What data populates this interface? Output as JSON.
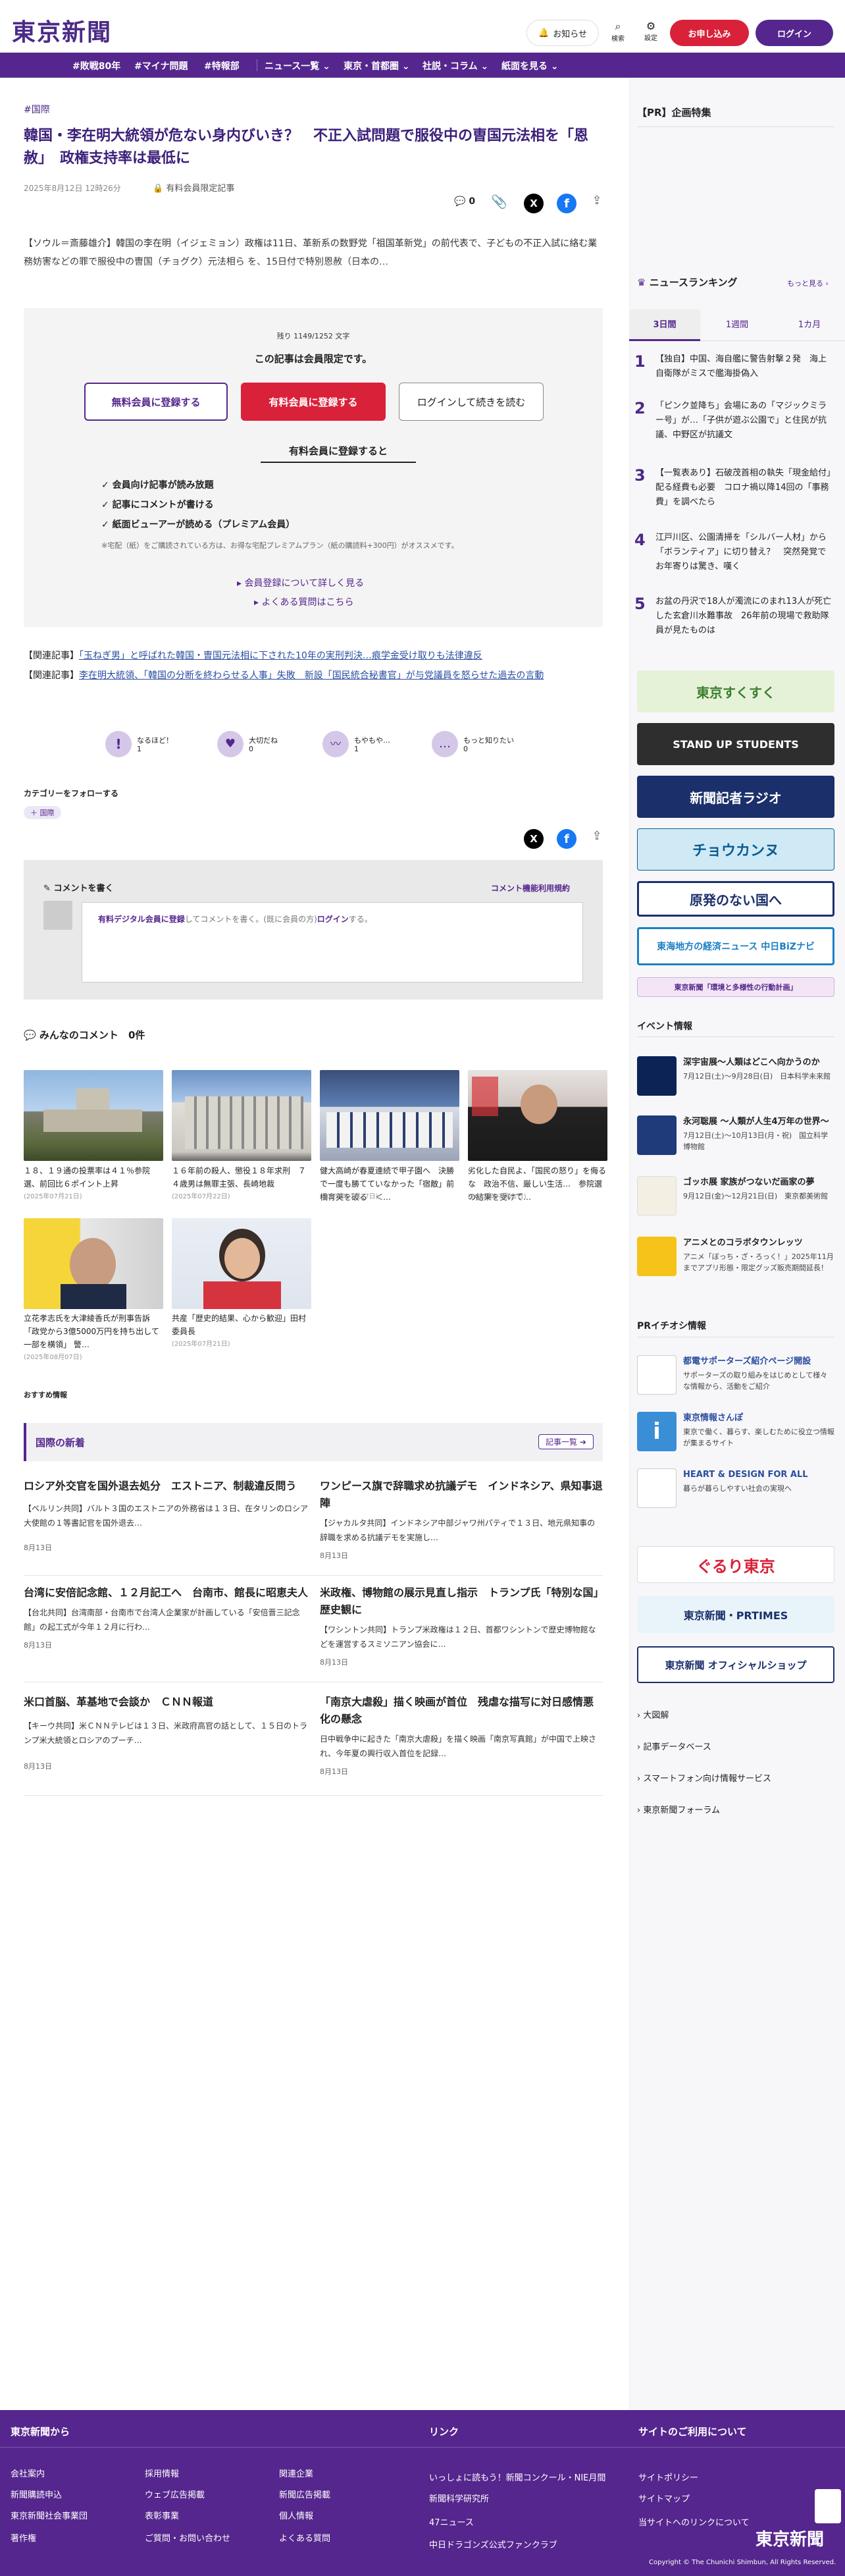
{
  "header": {
    "logo": "東京新聞",
    "notice": "お知らせ",
    "search": "検索",
    "settings": "設定",
    "signup": "お申し込み",
    "login": "ログイン"
  },
  "nav": {
    "items": [
      "#敗戦80年",
      "#マイナ問題",
      "#特報部",
      "ニュース一覧",
      "東京・首都圏",
      "社説・コラム",
      "紙面を見る"
    ]
  },
  "article": {
    "tag": "#国際",
    "title": "韓国・李在明大統領が危ない身内びいき？　不正入試問題で服役中の曺国元法相を「恩赦」　政権支持率は最低に",
    "date": "2025年8月12日 12時26分",
    "member_label": "有料会員限定記事",
    "comment_count": "0",
    "lead": "【ソウル＝斎藤雄介】韓国の李在明（イジェミョン）政権は11日、革新系の数野党「祖国革新党」の前代表で、子どもの不正入試に絡む業務妨害などの罪で服役中の曺国（チョグク）元法相ら を、15日付で特別恩赦（日本の…",
    "remaining": "残り 1149/1252 文字",
    "limited": "この記事は会員限定です。",
    "btn_free": "無料会員に登録する",
    "btn_paid": "有料会員に登録する",
    "btn_login": "ログインして続きを読む",
    "benefits_title": "有料会員に登録すると",
    "benefits": [
      "✓ 会員向け記事が読み放題",
      "✓ 記事にコメントが書ける",
      "✓ 紙面ビューアーが読める（プレミアム会員）"
    ],
    "note": "※宅配（紙）をご購読されている方は、お得な宅配プレミアムプラン（紙の購読料+300円）がオススメです。",
    "more1": "会員登録について詳しく見る",
    "more2": "よくある質問はこちら",
    "related1_label": "【関連記事】",
    "related1": "「玉ねぎ男」と呼ばれた韓国・曺国元法相に下された10年の実刑判決…痕学金受け取りも法律違反",
    "related2_label": "【関連記事】",
    "related2": "李在明大統領、「韓国の分断を終わらせる人事」失敗　新設「国民統合秘書官」が与党議員を怒らせた過去の言動",
    "reactions": [
      {
        "label": "なるほど！",
        "count": "1"
      },
      {
        "label": "大切だね",
        "count": "0"
      },
      {
        "label": "もやもや…",
        "count": "1"
      },
      {
        "label": "もっと知りたい",
        "count": "0"
      }
    ],
    "follow_label": "カテゴリーをフォローする",
    "follow_tag": "国際"
  },
  "comment": {
    "title": "コメントを書く",
    "rules": "コメント機能利用規約",
    "prompt_link": "有料デジタル会員に登録",
    "prompt_mid": "してコメントを書く。(既に会員の方)",
    "prompt_login": "ログイン",
    "prompt_end": "する。",
    "all_label": "みんなのコメント",
    "all_count": "0件"
  },
  "thumbs": [
    {
      "caption": "１８、１９通の投票率は４１％参院選、前回比６ポイント上昇",
      "date": "(2025年07月21日)"
    },
    {
      "caption": "１６年前の殺人、懲役１８年求刑　７４歳男は無罪主張、長崎地裁",
      "date": "(2025年07月22日)"
    },
    {
      "caption": "健大高崎が春夏連続で甲子園へ　決勝で一度も勝てていなかった「宿敵」前橋育英を破る　＜…",
      "date": "(2025年07月27日)"
    },
    {
      "caption": "劣化した自民よ、「国民の怒り」を侮るな　政治不信、厳しい生活…　参院選の結果を受けて…",
      "date": "(2025年07月21日)"
    },
    {
      "caption": "立花孝志氏を大津綾香氏が刑事告訴　「政党から3億5000万円を持ち出して一部を横領」 警…",
      "date": "(2025年08月07日)"
    },
    {
      "caption": "共産「歴史的結果、心から歓迎」田村委員長",
      "date": "(2025年07月21日)"
    }
  ],
  "recommend": "おすすめ情報",
  "intl": {
    "title": "国際の新着",
    "more": "記事一覧",
    "items": [
      {
        "title": "ロシア外交官を国外退去処分　エストニア、制裁違反問う",
        "body": "【ベルリン共同】バルト３国のエストニアの外務省は１３日、在タリンのロシア大使館の１等書記官を国外退去…",
        "date": "8月13日"
      },
      {
        "title": "ワンピース旗で辞職求め抗議デモ　インドネシア、県知事退陣",
        "body": "【ジャカルタ共同】インドネシア中部ジャワ州パティで１３日、地元県知事の辞職を求める抗議デモを実施し…",
        "date": "8月13日"
      },
      {
        "title": "台湾に安倍記念館、１２月記工へ　台南市、館長に昭恵夫人",
        "body": "【台北共同】台湾南部・台南市で台湾人企業家が計画している「安倍晋三記念館」の起工式が今年１２月に行わ…",
        "date": "8月13日"
      },
      {
        "title": "米政権、博物館の展示見直し指示　トランプ氏「特別な国」歴史観に",
        "body": "【ワシントン共同】トランプ米政権は１２日、首都ワシントンで歴史博物館などを運営するスミソニアン協会に…",
        "date": "8月13日"
      },
      {
        "title": "米口首脳、革基地で会談か　ＣＮＮ報道",
        "body": "【キーウ共同】米ＣＮＮテレビは１３日、米政府高官の話として、１５日のトランプ米大統領とロシアのプーチ…",
        "date": "8月13日"
      },
      {
        "title": "「南京大虐殺」描く映画が首位　残虐な描写に対日感情悪化の懸念",
        "body": "日中戦争中に起きた「南京大虐殺」を描く映画「南京写真館」が中国で上映され、今年夏の興行収入首位を記録…",
        "date": "8月13日"
      }
    ]
  },
  "sidebar": {
    "pr": "【PR】企画特集",
    "ranking_title": "ニュースランキング",
    "ranking_more": "もっと見る",
    "tabs": [
      "3日間",
      "1週間",
      "1カ月"
    ],
    "ranking": [
      {
        "n": "1",
        "text": "【独自】中国、海自艦に警告射撃２発　海上自衛隊がミスで艦海掛偽入"
      },
      {
        "n": "2",
        "text": "「ピンク並降ち」会場にあの「マジックミラー号」が…「子供が遊ぶ公園で」と住民が抗議、中野区が抗議文"
      },
      {
        "n": "3",
        "text": "【一覧表あり】石破茂首相の執失「現金給付」配る経費も必要　コロナ禍以降14回の「事務費」を調べたら"
      },
      {
        "n": "4",
        "text": "江戸川区、公園清掃を「シルバー人材」から「ボランティア」に切り替え？　突然発覚でお年寄りは驚き、嘆く"
      },
      {
        "n": "5",
        "text": "お盆の丹沢で18人が濁流にのまれ13人が死亡した玄倉川水難事故　26年前の現場で救助隊員が見たものは"
      }
    ],
    "banners": [
      "東京すくすく",
      "STAND UP STUDENTS",
      "新聞記者ラジオ",
      "チョウカンヌ",
      "原発のない国へ",
      "東海地方の経済ニュース 中日BiZナビ",
      "東京新聞「環境と多様性の行動計画」"
    ],
    "event_title": "イベント情報",
    "events": [
      {
        "title": "深宇宙展〜人類はどこへ向かうのか",
        "sub": "7月12日(土)〜9月28日(日)　日本科学未来館"
      },
      {
        "title": "永河聡展 〜人類が人生4万年の世界〜",
        "sub": "7月12日(土)〜10月13日(月・祝)　国立科学博物館"
      },
      {
        "title": "ゴッホ展 家族がつないだ画家の夢",
        "sub": "9月12日(金)〜12月21日(日)　東京都美術館"
      },
      {
        "title": "アニメとのコラボタウンレッツ",
        "sub": "アニメ「ぼっち・ざ・ろっく！」2025年11月までアプリ形態・限定グッズ販売期間延長！"
      }
    ],
    "pr_title": "PRイチオシ情報",
    "pr_items": [
      {
        "title": "都電サポーターズ紹介ページ開設",
        "sub": "サポーターズの取り組みをはじめとして様々な情報から、活動をご紹介"
      },
      {
        "title": "東京情報さんぽ",
        "sub": "東京で働く、暮らす、楽しむために役立つ情報が集まるサイト"
      },
      {
        "title": "HEART & DESIGN FOR ALL",
        "sub": "暮らが暮らしやすい社会の実現へ"
      }
    ],
    "banners2": [
      "ぐるり東京",
      "東京新聞・PRTIMES",
      "東京新聞 オフィシャルショップ"
    ],
    "links": [
      "大図解",
      "記事データベース",
      "スマートフォン向け情報サービス",
      "東京新聞フォーラム"
    ]
  },
  "footer": {
    "col1_title": "東京新聞から",
    "col1": [
      "会社案内",
      "新聞購読申込",
      "東京新聞社会事業団",
      "著作権",
      "採用情報",
      "ウェブ広告掲載",
      "表彰事業",
      "ご質問・お問い合わせ",
      "関連企業",
      "新聞広告掲載",
      "個人情報",
      "よくある質問"
    ],
    "col2_title": "リンク",
    "col2": [
      "いっしょに読もう！新聞コンクール・NIE月間",
      "新聞科学研究所",
      "47ニュース",
      "中日ドラゴンズ公式ファンクラブ"
    ],
    "col3_title": "サイトのご利用について",
    "col3": [
      "サイトポリシー",
      "サイトマップ",
      "当サイトへのリンクについて"
    ],
    "logo": "東京新聞",
    "copyright": "Copyright © The Chunichi Shimbun, All Rights Reserved."
  }
}
